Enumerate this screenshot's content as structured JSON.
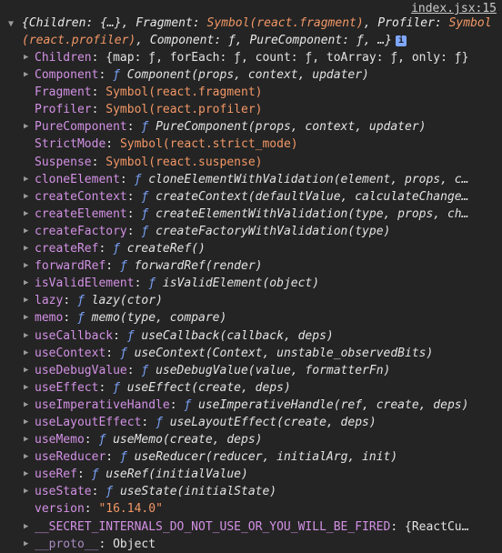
{
  "source_link": "index.jsx:15",
  "summary": {
    "part1": "{Children: {…}, Fragment: ",
    "fragment_sym": "Symbol(react.fragment)",
    "part2": ", Profiler: ",
    "profiler_sym": "Symbol(react.profiler)",
    "part3": ", Component: ƒ, PureComponent: ƒ, …}",
    "info_badge": "i"
  },
  "rows": [
    {
      "key": "Children",
      "expandable": true,
      "type": "obj",
      "value": "{map: ƒ, forEach: ƒ, count: ƒ, toArray: ƒ, only: ƒ}"
    },
    {
      "key": "Component",
      "expandable": true,
      "type": "fn",
      "value": "Component(props, context, updater)"
    },
    {
      "key": "Fragment",
      "expandable": false,
      "type": "sym",
      "value": "Symbol(react.fragment)"
    },
    {
      "key": "Profiler",
      "expandable": false,
      "type": "sym",
      "value": "Symbol(react.profiler)"
    },
    {
      "key": "PureComponent",
      "expandable": true,
      "type": "fn",
      "value": "PureComponent(props, context, updater)"
    },
    {
      "key": "StrictMode",
      "expandable": false,
      "type": "sym",
      "value": "Symbol(react.strict_mode)"
    },
    {
      "key": "Suspense",
      "expandable": false,
      "type": "sym",
      "value": "Symbol(react.suspense)"
    },
    {
      "key": "cloneElement",
      "expandable": true,
      "type": "fn",
      "value": "cloneElementWithValidation(element, props, c…"
    },
    {
      "key": "createContext",
      "expandable": true,
      "type": "fn",
      "value": "createContext(defaultValue, calculateChange…"
    },
    {
      "key": "createElement",
      "expandable": true,
      "type": "fn",
      "value": "createElementWithValidation(type, props, ch…"
    },
    {
      "key": "createFactory",
      "expandable": true,
      "type": "fn",
      "value": "createFactoryWithValidation(type)"
    },
    {
      "key": "createRef",
      "expandable": true,
      "type": "fn",
      "value": "createRef()"
    },
    {
      "key": "forwardRef",
      "expandable": true,
      "type": "fn",
      "value": "forwardRef(render)"
    },
    {
      "key": "isValidElement",
      "expandable": true,
      "type": "fn",
      "value": "isValidElement(object)"
    },
    {
      "key": "lazy",
      "expandable": true,
      "type": "fn",
      "value": "lazy(ctor)"
    },
    {
      "key": "memo",
      "expandable": true,
      "type": "fn",
      "value": "memo(type, compare)"
    },
    {
      "key": "useCallback",
      "expandable": true,
      "type": "fn",
      "value": "useCallback(callback, deps)"
    },
    {
      "key": "useContext",
      "expandable": true,
      "type": "fn",
      "value": "useContext(Context, unstable_observedBits)"
    },
    {
      "key": "useDebugValue",
      "expandable": true,
      "type": "fn",
      "value": "useDebugValue(value, formatterFn)"
    },
    {
      "key": "useEffect",
      "expandable": true,
      "type": "fn",
      "value": "useEffect(create, deps)"
    },
    {
      "key": "useImperativeHandle",
      "expandable": true,
      "type": "fn",
      "value": "useImperativeHandle(ref, create, deps)"
    },
    {
      "key": "useLayoutEffect",
      "expandable": true,
      "type": "fn",
      "value": "useLayoutEffect(create, deps)"
    },
    {
      "key": "useMemo",
      "expandable": true,
      "type": "fn",
      "value": "useMemo(create, deps)"
    },
    {
      "key": "useReducer",
      "expandable": true,
      "type": "fn",
      "value": "useReducer(reducer, initialArg, init)"
    },
    {
      "key": "useRef",
      "expandable": true,
      "type": "fn",
      "value": "useRef(initialValue)"
    },
    {
      "key": "useState",
      "expandable": true,
      "type": "fn",
      "value": "useState(initialState)"
    },
    {
      "key": "version",
      "expandable": false,
      "type": "str",
      "value": "\"16.14.0\""
    },
    {
      "key": "__SECRET_INTERNALS_DO_NOT_USE_OR_YOU_WILL_BE_FIRED",
      "expandable": true,
      "type": "obj",
      "value": "{ReactCu…"
    },
    {
      "key": "__proto__",
      "expandable": true,
      "type": "proto",
      "value": "Object"
    }
  ],
  "glyphs": {
    "expand_arrow": "▶",
    "collapse_arrow": "▼",
    "fn_keyword": "ƒ"
  },
  "colors": {
    "background": "#242424",
    "key": "#d291e4",
    "symbol_string": "#f29766",
    "function_keyword": "#7aa2f7"
  }
}
